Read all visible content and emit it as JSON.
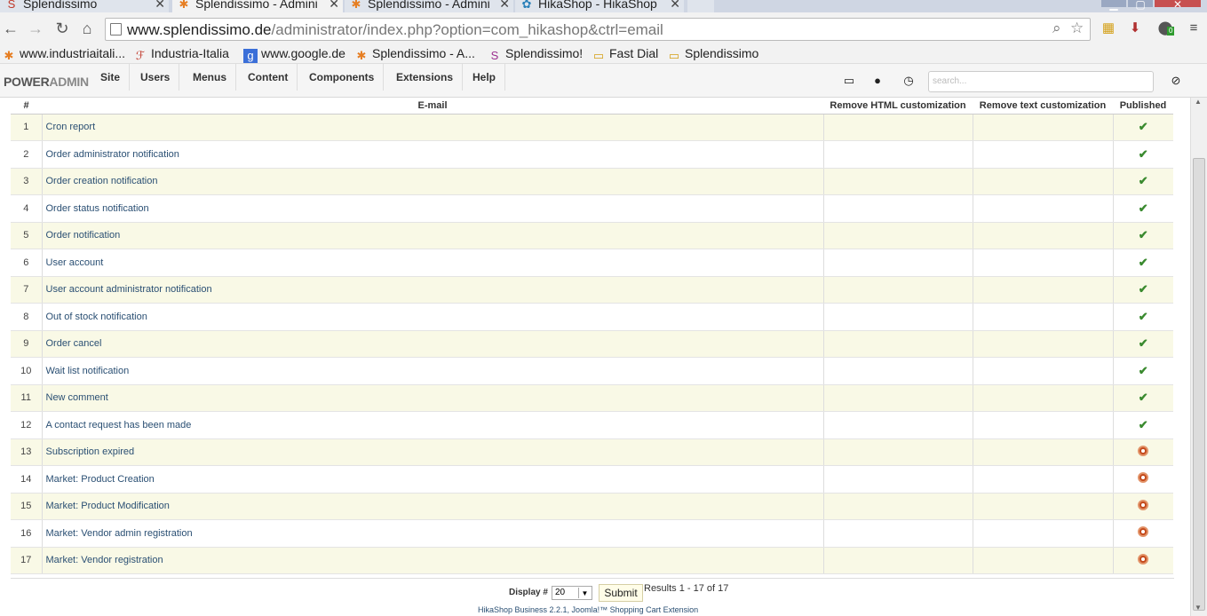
{
  "browser": {
    "tabs": [
      {
        "label": "Splendissimo",
        "icon": "splendissimo-icon"
      },
      {
        "label": "Splendissimo - Admini",
        "icon": "joomla-icon"
      },
      {
        "label": "Splendissimo - Admini",
        "icon": "joomla-icon"
      },
      {
        "label": "HikaShop - HikaShop",
        "icon": "hikashop-icon"
      }
    ],
    "url_host": "www.splendissimo.de",
    "url_path": "/administrator/index.php?option=com_hikashop&ctrl=email",
    "extension_badge": "0"
  },
  "bookmarks": [
    {
      "label": "www.industriaitali...",
      "icon": "joomla-icon"
    },
    {
      "label": "Industria-Italia",
      "icon": "industria-icon"
    },
    {
      "label": "www.google.de",
      "icon": "google-icon"
    },
    {
      "label": "Splendissimo - A...",
      "icon": "joomla-icon"
    },
    {
      "label": "Splendissimo!",
      "icon": "splendissimo-icon"
    },
    {
      "label": "Fast Dial",
      "icon": "folder-icon"
    },
    {
      "label": "Splendissimo",
      "icon": "folder-icon"
    }
  ],
  "admin": {
    "brand_bold": "POWER",
    "brand_light": "ADMIN",
    "menu": [
      "Site",
      "Users",
      "Menus",
      "Content",
      "Components",
      "Extensions",
      "Help"
    ],
    "search_placeholder": "search..."
  },
  "table": {
    "headers": [
      "#",
      "E-mail",
      "Remove HTML customization",
      "Remove text customization",
      "Published"
    ],
    "rows": [
      {
        "num": "1",
        "email": "Cron report",
        "published": true
      },
      {
        "num": "2",
        "email": "Order administrator notification",
        "published": true
      },
      {
        "num": "3",
        "email": "Order creation notification",
        "published": true
      },
      {
        "num": "4",
        "email": "Order status notification",
        "published": true
      },
      {
        "num": "5",
        "email": "Order notification",
        "published": true
      },
      {
        "num": "6",
        "email": "User account",
        "published": true
      },
      {
        "num": "7",
        "email": "User account administrator notification",
        "published": true
      },
      {
        "num": "8",
        "email": "Out of stock notification",
        "published": true
      },
      {
        "num": "9",
        "email": "Order cancel",
        "published": true
      },
      {
        "num": "10",
        "email": "Wait list notification",
        "published": true
      },
      {
        "num": "11",
        "email": "New comment",
        "published": true
      },
      {
        "num": "12",
        "email": "A contact request has been made",
        "published": true
      },
      {
        "num": "13",
        "email": "Subscription expired",
        "published": false
      },
      {
        "num": "14",
        "email": "Market: Product Creation",
        "published": false
      },
      {
        "num": "15",
        "email": "Market: Product Modification",
        "published": false
      },
      {
        "num": "16",
        "email": "Market: Vendor admin registration",
        "published": false
      },
      {
        "num": "17",
        "email": "Market: Vendor registration",
        "published": false
      }
    ]
  },
  "pager": {
    "display_label": "Display #",
    "display_value": "20",
    "submit_label": "Submit",
    "results": "Results 1 - 17 of 17",
    "footer": "HikaShop Business 2.2.1, Joomla!™ Shopping Cart Extension"
  },
  "colors": {
    "published": "#3a8a2f",
    "unpublished": "#c44a1c"
  }
}
